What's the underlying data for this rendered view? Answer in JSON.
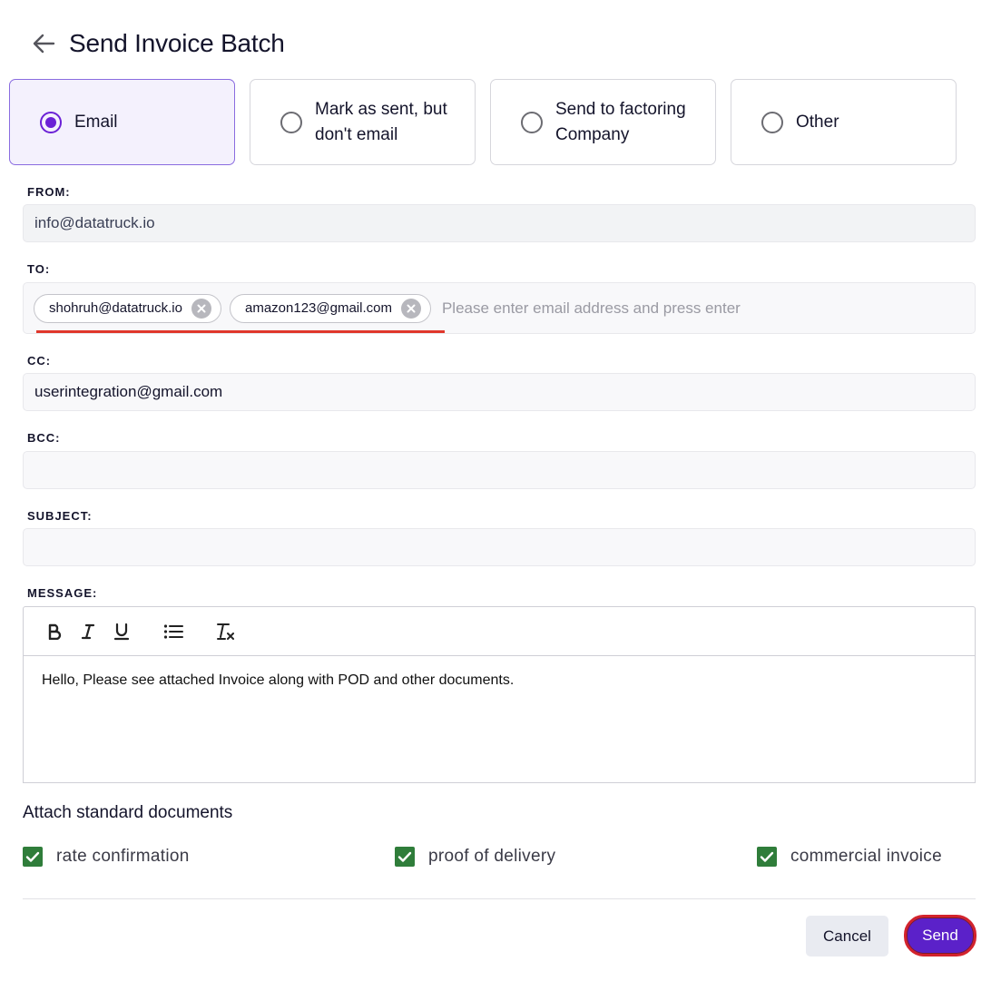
{
  "header": {
    "title": "Send Invoice Batch"
  },
  "options": [
    {
      "label": "Email",
      "selected": true
    },
    {
      "label": "Mark as sent, but\ndon't email",
      "selected": false
    },
    {
      "label": "Send to factoring\nCompany",
      "selected": false
    },
    {
      "label": "Other",
      "selected": false
    }
  ],
  "from": {
    "label": "FROM:",
    "value": "info@datatruck.io"
  },
  "to": {
    "label": "TO:",
    "chips": [
      "shohruh@datatruck.io",
      "amazon123@gmail.com"
    ],
    "placeholder": "Please enter email address and press enter"
  },
  "cc": {
    "label": "CC:",
    "value": "userintegration@gmail.com"
  },
  "bcc": {
    "label": "BCC:",
    "value": ""
  },
  "subject": {
    "label": "SUBJECT:",
    "value": ""
  },
  "message": {
    "label": "MESSAGE:",
    "toolbar": [
      "bold-icon",
      "italic-icon",
      "underline-icon",
      "bulleted-list-icon",
      "clear-formatting-icon"
    ],
    "body": "Hello, Please see attached Invoice along with POD and other documents."
  },
  "attachments": {
    "title": "Attach standard documents",
    "items": [
      {
        "label": "rate confirmation",
        "checked": true
      },
      {
        "label": "proof of delivery",
        "checked": true
      },
      {
        "label": "commercial invoice",
        "checked": true
      }
    ]
  },
  "actions": {
    "cancel": "Cancel",
    "send": "Send"
  },
  "colors": {
    "accent": "#5b21c9",
    "checkbox": "#2f7d3a",
    "highlight": "#e0372b"
  }
}
